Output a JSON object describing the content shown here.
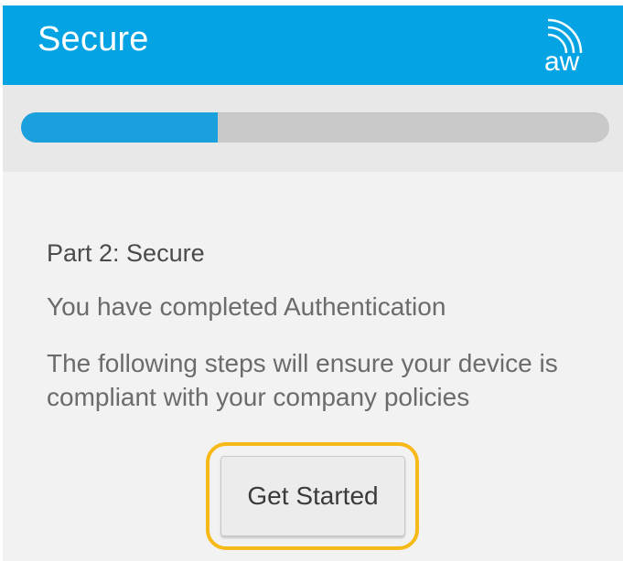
{
  "header": {
    "title": "Secure",
    "logo": {
      "icon": "airwatch-logo-icon",
      "text": "aw"
    },
    "background_color": "#04a3e3"
  },
  "progress": {
    "value": 0.335,
    "fill_color": "#1aa0dc",
    "track_color": "#c9c9c9"
  },
  "main": {
    "heading": "Part 2: Secure",
    "completed_message": "You have completed Authentication",
    "description": "The following steps will ensure your device is compliant with your company policies",
    "get_started_label": "Get Started",
    "highlight_color": "#f6b917"
  }
}
